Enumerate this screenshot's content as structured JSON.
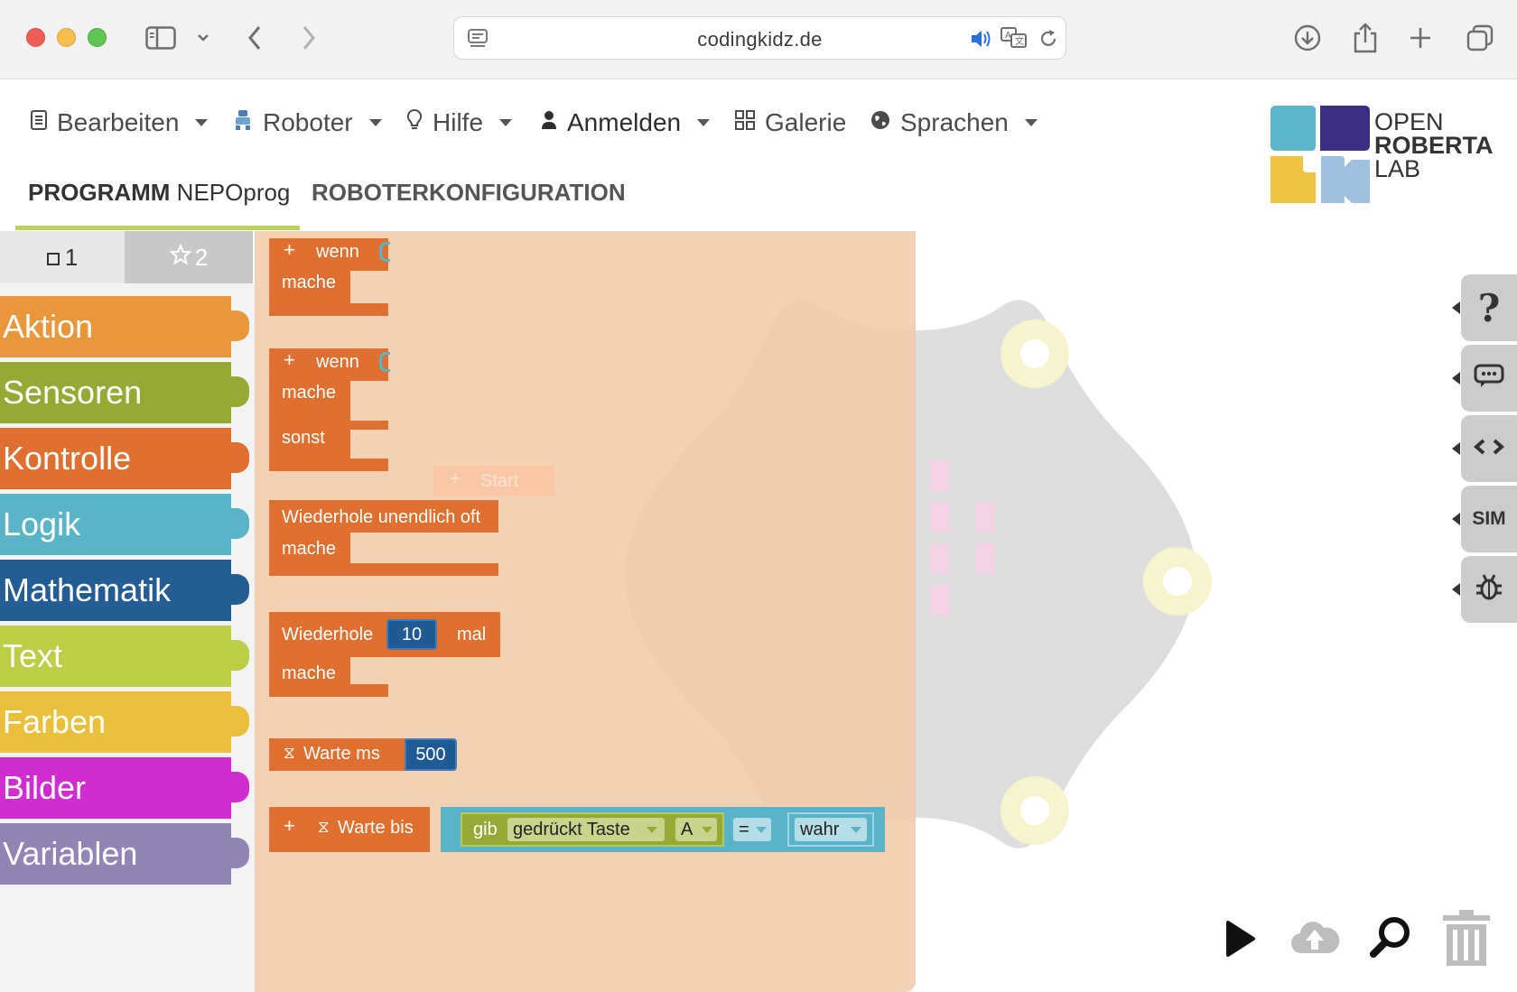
{
  "browser": {
    "url": "codingkidz.de"
  },
  "nav": {
    "menu": [
      {
        "label": "Bearbeiten",
        "icon": "document-icon"
      },
      {
        "label": "Roboter",
        "icon": "robot-icon"
      },
      {
        "label": "Hilfe",
        "icon": "lightbulb-icon"
      },
      {
        "label": "Anmelden",
        "icon": "user-icon"
      },
      {
        "label": "Galerie",
        "icon": "grid-icon"
      },
      {
        "label": "Sprachen",
        "icon": "globe-icon"
      }
    ],
    "tab_program_bold": "PROGRAMM",
    "tab_program_name": "NEPOprog",
    "tab_config": "ROBOTERKONFIGURATION"
  },
  "logo": {
    "line1": "OPEN",
    "line2": "ROBERTA",
    "line3": "LAB"
  },
  "toolbox": {
    "tab1_label": "1",
    "tab2_label": "2",
    "categories": [
      {
        "label": "Aktion",
        "color": "#e8983a"
      },
      {
        "label": "Sensoren",
        "color": "#96a935"
      },
      {
        "label": "Kontrolle",
        "color": "#e07030"
      },
      {
        "label": "Logik",
        "color": "#5ab4c8"
      },
      {
        "label": "Mathematik",
        "color": "#245c94"
      },
      {
        "label": "Text",
        "color": "#bccd46"
      },
      {
        "label": "Farben",
        "color": "#e8c03c"
      },
      {
        "label": "Bilder",
        "color": "#d02dd0"
      },
      {
        "label": "Variablen",
        "color": "#9284b4"
      }
    ]
  },
  "blocks": {
    "if1_wenn": "wenn",
    "if1_mache": "mache",
    "if2_wenn": "wenn",
    "if2_mache": "mache",
    "if2_sonst": "sonst",
    "ghost_start": "Start",
    "forever_label": "Wiederhole unendlich oft",
    "forever_mache": "mache",
    "repeat_label": "Wiederhole",
    "repeat_value": "10",
    "repeat_mal": "mal",
    "repeat_mache": "mache",
    "wait_label": "Warte ms",
    "wait_value": "500",
    "waituntil_label": "Warte bis",
    "cond_gib": "gib",
    "cond_gedrueckt": "gedrückt",
    "cond_taste": "Taste",
    "cond_key": "A",
    "cond_op": "=",
    "cond_value": "wahr"
  },
  "side_buttons": [
    {
      "icon": "help-icon"
    },
    {
      "icon": "comment-icon"
    },
    {
      "icon": "code-icon"
    },
    {
      "icon": "sim-icon",
      "label": "SIM"
    },
    {
      "icon": "bug-icon"
    }
  ],
  "colors": {
    "control": "#e07030",
    "logic": "#5ab4c8",
    "sensor": "#96a935",
    "math": "#245c94",
    "flyout_bg": "#f3d2b3"
  }
}
